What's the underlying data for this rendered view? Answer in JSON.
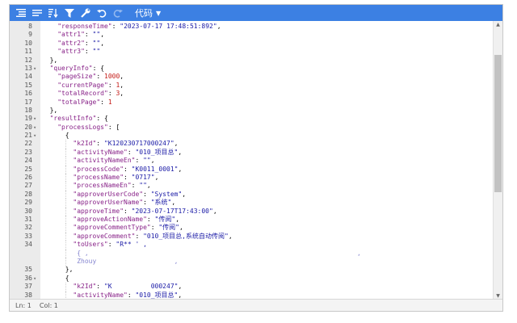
{
  "toolbar": {
    "buttons": [
      {
        "name": "format-icon"
      },
      {
        "name": "compact-icon"
      },
      {
        "name": "sort-icon"
      },
      {
        "name": "filter-icon"
      },
      {
        "name": "repair-icon"
      },
      {
        "name": "undo-icon"
      },
      {
        "name": "redo-icon"
      }
    ],
    "mode_label": "代码"
  },
  "lines": [
    {
      "num": "8",
      "fold": "",
      "indent": 2,
      "html": "<span class='k'>\"responseTime\"</span>: <span class='s'>\"2023-07-17 17:48:51:892\"</span>,"
    },
    {
      "num": "9",
      "fold": "",
      "indent": 2,
      "html": "<span class='k'>\"attr1\"</span>: <span class='s'>\"\"</span>,"
    },
    {
      "num": "10",
      "fold": "",
      "indent": 2,
      "html": "<span class='k'>\"attr2\"</span>: <span class='s'>\"\"</span>,"
    },
    {
      "num": "11",
      "fold": "",
      "indent": 2,
      "html": "<span class='k'>\"attr3\"</span>: <span class='s'>\"\"</span>"
    },
    {
      "num": "12",
      "fold": "",
      "indent": 1,
      "html": "},"
    },
    {
      "num": "13",
      "fold": "▾",
      "indent": 1,
      "html": "<span class='k'>\"queryInfo\"</span>: {"
    },
    {
      "num": "14",
      "fold": "",
      "indent": 2,
      "html": "<span class='k'>\"pageSize\"</span>: <span class='n'>1000</span>,"
    },
    {
      "num": "15",
      "fold": "",
      "indent": 2,
      "html": "<span class='k'>\"currentPage\"</span>: <span class='n'>1</span>,"
    },
    {
      "num": "16",
      "fold": "",
      "indent": 2,
      "html": "<span class='k'>\"totalRecord\"</span>: <span class='n'>3</span>,"
    },
    {
      "num": "17",
      "fold": "",
      "indent": 2,
      "html": "<span class='k'>\"totalPage\"</span>: <span class='n'>1</span>"
    },
    {
      "num": "18",
      "fold": "",
      "indent": 1,
      "html": "},"
    },
    {
      "num": "19",
      "fold": "▾",
      "indent": 1,
      "html": "<span class='k'>\"resultInfo\"</span>: {"
    },
    {
      "num": "20",
      "fold": "▾",
      "indent": 2,
      "html": "<span class='k'>\"processLogs\"</span>: ["
    },
    {
      "num": "21",
      "fold": "▾",
      "indent": 3,
      "html": "{"
    },
    {
      "num": "22",
      "fold": "",
      "indent": 4,
      "html": "<span class='k'>\"k2Id\"</span>: <span class='s'>\"K120230717000247\"</span>,"
    },
    {
      "num": "23",
      "fold": "",
      "indent": 4,
      "html": "<span class='k'>\"activityName\"</span>: <span class='s'>\"010_项目总\"</span>,"
    },
    {
      "num": "24",
      "fold": "",
      "indent": 4,
      "html": "<span class='k'>\"activityNameEn\"</span>: <span class='s'>\"\"</span>,"
    },
    {
      "num": "25",
      "fold": "",
      "indent": 4,
      "html": "<span class='k'>\"processCode\"</span>: <span class='s'>\"K0011_0001\"</span>,"
    },
    {
      "num": "26",
      "fold": "",
      "indent": 4,
      "html": "<span class='k'>\"processName\"</span>: <span class='s'>\"0717\"</span>,"
    },
    {
      "num": "27",
      "fold": "",
      "indent": 4,
      "html": "<span class='k'>\"processNameEn\"</span>: <span class='s'>\"\"</span>,"
    },
    {
      "num": "28",
      "fold": "",
      "indent": 4,
      "html": "<span class='k'>\"approverUserCode\"</span>: <span class='s'>\"System\"</span>,"
    },
    {
      "num": "29",
      "fold": "",
      "indent": 4,
      "html": "<span class='k'>\"approverUserName\"</span>: <span class='s'>\"系统\"</span>,"
    },
    {
      "num": "30",
      "fold": "",
      "indent": 4,
      "html": "<span class='k'>\"approveTime\"</span>: <span class='s'>\"2023-07-17T17:43:00\"</span>,"
    },
    {
      "num": "31",
      "fold": "",
      "indent": 4,
      "html": "<span class='k'>\"approveActionName\"</span>: <span class='s'>\"传阅\"</span>,"
    },
    {
      "num": "32",
      "fold": "",
      "indent": 4,
      "html": "<span class='k'>\"approveCommentType\"</span>: <span class='s'>\"传阅\"</span>,"
    },
    {
      "num": "33",
      "fold": "",
      "indent": 4,
      "html": "<span class='k'>\"approveComment\"</span>: <span class='s'>\"010_项目总,系统自动传阅\"</span>,"
    },
    {
      "num": "34",
      "fold": "",
      "indent": 4,
      "html": "<span class='k'>\"toUsers\"</span>: <span class='s'>\"R** ' ,</span>"
    },
    {
      "num": "",
      "fold": "",
      "indent": 4,
      "html": " <span class='s' style='opacity:.55'>{ ,                                                                     ,</span>"
    },
    {
      "num": "",
      "fold": "",
      "indent": 4,
      "html": " <span class='s' style='opacity:.55'>Zhouy                    ,</span>"
    },
    {
      "num": "35",
      "fold": "",
      "indent": 3,
      "html": "},"
    },
    {
      "num": "36",
      "fold": "▾",
      "indent": 3,
      "html": "{"
    },
    {
      "num": "37",
      "fold": "",
      "indent": 4,
      "html": "<span class='k'>\"k2Id\"</span>: <span class='s'>\"K          000247\"</span>,"
    },
    {
      "num": "38",
      "fold": "",
      "indent": 4,
      "html": "<span class='k'>\"activityName\"</span>: <span class='s'>\"010_项目总\"</span>,"
    }
  ],
  "status": {
    "line_label": "Ln: 1",
    "col_label": "Col: 1"
  }
}
